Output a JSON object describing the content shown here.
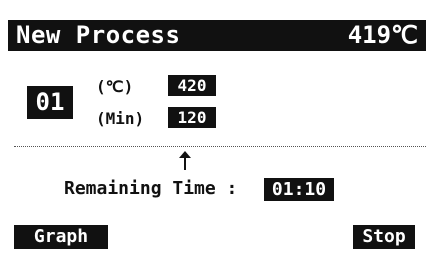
{
  "header": {
    "title": "New Process",
    "current_temp": "419℃"
  },
  "step": {
    "number": "01"
  },
  "params": {
    "temp_label": "(℃)",
    "temp_value": "420",
    "time_label": "(Min)",
    "time_value": "120"
  },
  "remaining": {
    "label": "Remaining Time :",
    "value": "01:10"
  },
  "softkeys": {
    "left": "Graph",
    "right": "Stop"
  },
  "colors": {
    "foreground": "#111111",
    "background": "#ffffff"
  },
  "icons": {
    "pointer": "up-arrow-icon"
  }
}
